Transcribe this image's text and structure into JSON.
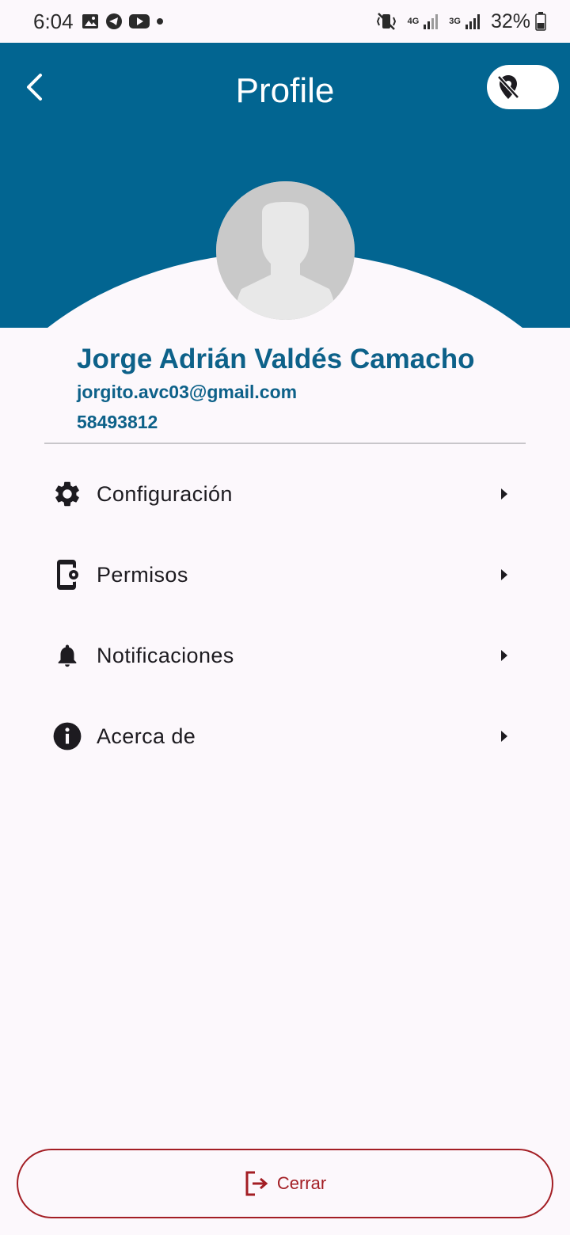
{
  "status_bar": {
    "time": "6:04",
    "network_a": "4G",
    "network_b": "3G",
    "battery": "32%",
    "icons": [
      "image-icon",
      "telegram-icon",
      "youtube-icon",
      "dot-icon",
      "vibrate-mute-icon",
      "signal-icon",
      "battery-icon"
    ]
  },
  "header": {
    "title": "Profile",
    "back_icon": "chevron-left-icon",
    "toggle_icon": "location-off-icon",
    "background": "#026591"
  },
  "profile": {
    "name": "Jorge Adrián Valdés Camacho",
    "email": "jorgito.avc03@gmail.com",
    "phone": "58493812",
    "accent": "#0d6189"
  },
  "menu": {
    "items": [
      {
        "label": "Configuración",
        "icon": "gear-icon"
      },
      {
        "label": "Permisos",
        "icon": "phone-settings-icon"
      },
      {
        "label": "Notificaciones",
        "icon": "bell-icon"
      },
      {
        "label": "Acerca de",
        "icon": "info-icon"
      }
    ]
  },
  "logout": {
    "label": "Cerrar",
    "icon": "logout-icon",
    "color": "#a31e24"
  }
}
